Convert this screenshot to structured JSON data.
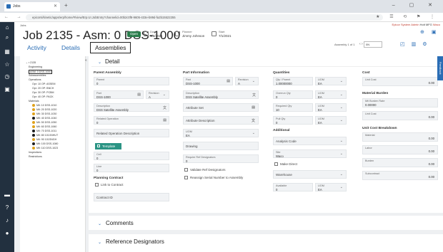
{
  "browser": {
    "tab_title": "Jobs",
    "url": "epicorsi/kinetic/apps/erp/home/#/view/Erp.UI.JobEntry?channelid=00b2c0f8-9605-433e-b89d-fa2b15522255",
    "window_controls": "– ▢ ✕",
    "nav_buttons": "← → ⟳",
    "extension_icons": "★ ☰ ⟲ ⚑ ⋮"
  },
  "header": {
    "breadcrumb": "Jobs",
    "admin_text": "Epicor System Admin",
    "admin_tag1": "Holt MFG",
    "admin_tag2": "Waco",
    "title": "Job 2135 - Asm: 0 DSS-1000",
    "status_badge": "Open",
    "due_label": "Due",
    "due_value": "7/6/2021",
    "planner_label": "Planner",
    "planner_value": "Jimmy Johnson",
    "start_label": "Start",
    "start_value": "7/1/2021",
    "tabs": [
      "Activity",
      "Details",
      "Assemblies"
    ],
    "assembly_nav": "Assembly 1 of 1",
    "assembly_select": "0N",
    "nav_arrows": "‹      ›"
  },
  "tree": {
    "root": "2135",
    "items": [
      {
        "label": "Engineering",
        "indent": 1
      },
      {
        "label": "ASM: 0 DSS-1000",
        "indent": 1,
        "selected": true
      },
      {
        "label": "Subassemblies",
        "indent": 1
      },
      {
        "label": "Operations",
        "indent": 1
      },
      {
        "label": "Opr: 10 OP: ASSEM",
        "indent": 2
      },
      {
        "label": "Opr: 20 OP: BNCH",
        "indent": 2
      },
      {
        "label": "Opr: 30 OP: PCBM",
        "indent": 2
      },
      {
        "label": "Opr: 40 OP: PACK",
        "indent": 2
      },
      {
        "label": "Materials",
        "indent": 1
      },
      {
        "label": "Mtl: 10 DSS-1010",
        "indent": 2,
        "dot": "#e0a21b"
      },
      {
        "label": "Mtl: 20 DSS-1020",
        "indent": 2,
        "dot": "#e0a21b"
      },
      {
        "label": "Mtl: 30 DSS-1030",
        "indent": 2,
        "dot": "#e0a21b"
      },
      {
        "label": "Mtl: 40 DSS-1040",
        "indent": 2,
        "dot": "#1d1d1d"
      },
      {
        "label": "Mtl: 50 DSS-1050",
        "indent": 2,
        "dot": "#e0a21b"
      },
      {
        "label": "Mtl: 60 DSS-1060",
        "indent": 2,
        "dot": "#e0a21b"
      },
      {
        "label": "Mtl: 70 DSS-1011",
        "indent": 2,
        "dot": "#1d1d1d"
      },
      {
        "label": "Mtl: 80 101XNHUT",
        "indent": 2,
        "dot": "#1d1d1d"
      },
      {
        "label": "Mtl: 90 101SNGH",
        "indent": 2,
        "dot": "#e0a21b"
      },
      {
        "label": "Mtl: 100 DSS-1080",
        "indent": 2,
        "dot": "#1d1d1d"
      },
      {
        "label": "Mtl: 110 DSS-1023",
        "indent": 2,
        "dot": "#e0a21b"
      },
      {
        "label": "Inspections",
        "indent": 1
      },
      {
        "label": "Restrictions",
        "indent": 1
      }
    ]
  },
  "detail": {
    "header": "Detail",
    "parent_assembly": {
      "section": "Parent Assembly",
      "parent_label": "Parent",
      "parent_value": "0",
      "part_label": "Part",
      "part_value": "DSS-1000",
      "revision_label": "Revision",
      "revision_value": "A",
      "description_label": "Description",
      "description_value": "DSS Satellite Assembly",
      "related_op_label": "Related Operation",
      "related_op_value": "0",
      "related_op_desc": "Related Operation Description",
      "template_label": "Template",
      "cell_label": "Cell",
      "cell_value": "0",
      "line_label": "Line",
      "line_value": "0",
      "planning_section": "Planning Contract",
      "link_contract_label": "Link to Contract",
      "contract_id_label": "Contract ID"
    },
    "part_information": {
      "section": "Part Information",
      "part_label": "Part",
      "part_value": "DSS-1000",
      "revision_label": "Revision",
      "revision_value": "A",
      "description_label": "Description",
      "description_value": "DSS Satellite Assembly",
      "attribute_set": "Attribute Set",
      "attribute_desc": "Attribute Description",
      "uom_label": "UOM",
      "uom_value": "EA",
      "drawing": "Drawing",
      "req_ref_label": "Require Ref Designators",
      "req_ref_value": "0",
      "validate_ref": "Validate Ref Designators",
      "reassign_serial": "Reassign Serial Number to Assembly"
    },
    "quantities": {
      "section": "Quantities",
      "qty_parent_label": "Qty / Parent",
      "qty_parent_value": "1.00000000",
      "uom_label": "UOM",
      "uom_value": "EA",
      "overrun_label": "Overrun Qty",
      "overrun_value": "0",
      "required_label": "Required Qty",
      "required_value": "10",
      "pull_label": "Pull Qty",
      "pull_value": "0",
      "additional": "Additional",
      "analysis_code": "Analysis Code",
      "site_label": "Site",
      "site_value": "Waco",
      "make_direct": "Make Direct",
      "warehouse": "Warehouse",
      "available_label": "Available",
      "available_value": "0",
      "uom2_value": "EA"
    },
    "cost": {
      "section": "Cost",
      "unit_cost_label": "Unit Cost",
      "unit_cost_value": "0.00",
      "burden_section": "Material Burden",
      "mtl_burden_rate_label": "Mtl Burden Rate",
      "mtl_burden_rate_value": "0.00000",
      "unit_cost2_label": "Unit Cost",
      "unit_cost2_value": "0.00",
      "breakdown_section": "Unit Cost Breakdown",
      "material_label": "Material",
      "material_value": "0.00",
      "labor_label": "Labor",
      "labor_value": "0.00",
      "burden_label": "Burden",
      "burden_value": "0.00",
      "subcontract_label": "Subcontract",
      "subcontract_value": "0.00"
    }
  },
  "cards": {
    "comments": "Comments",
    "reference": "Reference Designators"
  },
  "side_tab": "Feedback"
}
